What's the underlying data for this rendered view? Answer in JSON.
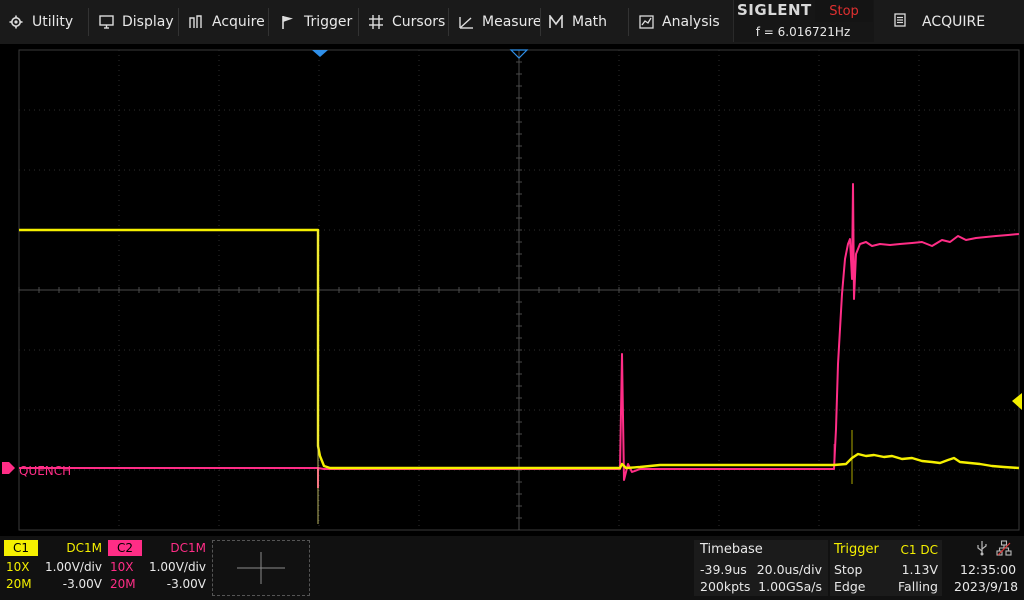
{
  "menu": {
    "items": [
      {
        "label": "Utility",
        "icon": "gear-icon"
      },
      {
        "label": "Display",
        "icon": "monitor-icon"
      },
      {
        "label": "Acquire",
        "icon": "acquire-icon"
      },
      {
        "label": "Trigger",
        "icon": "flag-icon"
      },
      {
        "label": "Cursors",
        "icon": "crosshair-icon"
      },
      {
        "label": "Measure",
        "icon": "measure-icon"
      },
      {
        "label": "Math",
        "icon": "math-icon"
      },
      {
        "label": "Analysis",
        "icon": "analysis-icon"
      }
    ]
  },
  "header": {
    "brand": "SIGLENT",
    "run_state": "Stop",
    "frequency": "f = 6.016721Hz",
    "mode": "ACQUIRE",
    "run_state_color": "#e03030"
  },
  "waveform": {
    "ch2_label": "QUENCH",
    "ch1_color": "#f5f000",
    "ch2_color": "#ff2d86"
  },
  "channels": [
    {
      "tag": "C1",
      "coupling": "DC1M",
      "probe": "10X",
      "scale": "1.00V/div",
      "bw": "20M",
      "offset": "-3.00V",
      "color": "#f5f000"
    },
    {
      "tag": "C2",
      "coupling": "DC1M",
      "probe": "10X",
      "scale": "1.00V/div",
      "bw": "20M",
      "offset": "-3.00V",
      "color": "#ff2d86"
    }
  ],
  "timebase": {
    "title": "Timebase",
    "delay": "-39.9us",
    "scale": "20.0us/div",
    "memory": "200kpts",
    "sample_rate": "1.00GSa/s"
  },
  "trigger": {
    "title": "Trigger",
    "source": "C1 DC",
    "state": "Stop",
    "level": "1.13V",
    "type": "Edge",
    "slope": "Falling"
  },
  "status": {
    "time": "12:35:00",
    "date": "2023/9/18"
  }
}
